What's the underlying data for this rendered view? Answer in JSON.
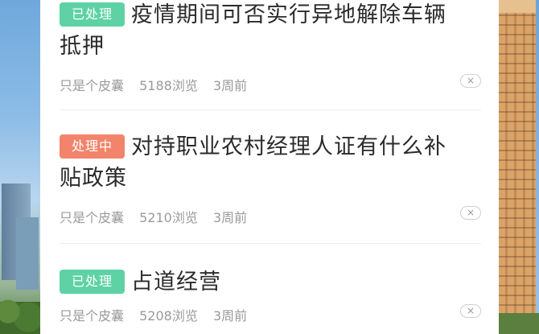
{
  "items": [
    {
      "status": "已处理",
      "title": "疫情期间可否实行异地解除车辆抵押",
      "title_line1": "疫情期间可否实行异地解除车辆",
      "title_line2": "抵押",
      "author": "只是个皮囊",
      "views": "5188浏览",
      "time": "3周前",
      "close_icon": "×"
    },
    {
      "status": "处理中",
      "title": "对持职业农村经理人证有什么补贴政策",
      "title_line1": "对持职业农村经理人证有什么补",
      "title_line2": "贴政策",
      "author": "只是个皮囊",
      "views": "5210浏览",
      "time": "3周前",
      "close_icon": "×"
    },
    {
      "status": "已处理",
      "title": "占道经营",
      "title_line1": "占道经营",
      "author": "只是个皮囊",
      "views": "5208浏览",
      "time": "3周前",
      "close_icon": "×"
    }
  ],
  "colors": {
    "status_done": "#5ed2a5",
    "status_processing": "#f2846c",
    "meta_text": "#9a9a9a",
    "title_text": "#2b2b2b"
  }
}
